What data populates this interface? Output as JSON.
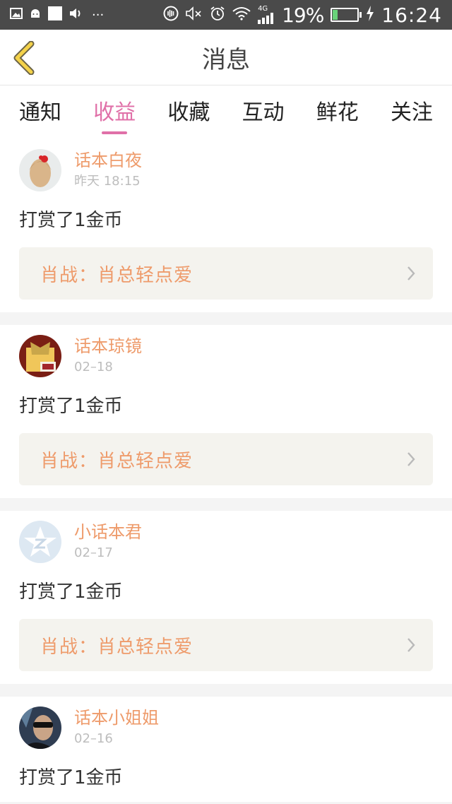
{
  "status_bar": {
    "left_icons": [
      "image-icon",
      "android-icon",
      "square-icon",
      "volume-icon",
      "more-icon"
    ],
    "more_text": "···",
    "network": "4G",
    "battery_percent": "19%",
    "battery_level": 0.19,
    "time": "16:24"
  },
  "header": {
    "title": "消息"
  },
  "tabs": [
    {
      "label": "通知"
    },
    {
      "label": "收益"
    },
    {
      "label": "收藏"
    },
    {
      "label": "互动"
    },
    {
      "label": "鲜花"
    },
    {
      "label": "关注"
    }
  ],
  "active_tab_index": 1,
  "messages": [
    {
      "user": "话本白夜",
      "time": "昨天  18:15",
      "action": "打赏了1金币",
      "work": "肖战：肖总轻点爱"
    },
    {
      "user": "话本琼镜",
      "time": "02–18",
      "action": "打赏了1金币",
      "work": "肖战：肖总轻点爱"
    },
    {
      "user": "小话本君",
      "time": "02–17",
      "action": "打赏了1金币",
      "work": "肖战：肖总轻点爱"
    },
    {
      "user": "话本小姐姐",
      "time": "02–16",
      "action": "打赏了1金币",
      "work": ""
    }
  ],
  "colors": {
    "accent": "#e070a8",
    "name": "#ee9b6b",
    "statusbar": "#4a4a4a"
  }
}
